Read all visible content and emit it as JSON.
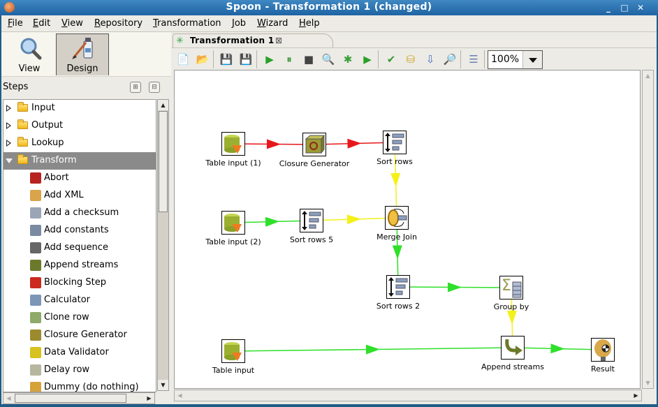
{
  "window": {
    "title": "Spoon - Transformation 1 (changed)",
    "controls": [
      "_",
      "□",
      "✕"
    ]
  },
  "menu": [
    {
      "label": "File",
      "mnemonic": "F"
    },
    {
      "label": "Edit",
      "mnemonic": "E"
    },
    {
      "label": "View",
      "mnemonic": "V"
    },
    {
      "label": "Repository",
      "mnemonic": "R"
    },
    {
      "label": "Transformation",
      "mnemonic": "T"
    },
    {
      "label": "Job",
      "mnemonic": "J"
    },
    {
      "label": "Wizard",
      "mnemonic": "W"
    },
    {
      "label": "Help",
      "mnemonic": "H"
    }
  ],
  "perspectives": {
    "view_label": "View",
    "design_label": "Design",
    "active": "Design"
  },
  "steps_panel": {
    "title": "Steps",
    "categories": [
      {
        "label": "Input",
        "expanded": false
      },
      {
        "label": "Output",
        "expanded": false
      },
      {
        "label": "Lookup",
        "expanded": false
      },
      {
        "label": "Transform",
        "expanded": true,
        "selected": true
      }
    ],
    "transform_steps": [
      {
        "label": "Abort",
        "icon": "abort-icon",
        "color": "#b8231f"
      },
      {
        "label": "Add XML",
        "icon": "add-xml-icon",
        "color": "#d9a44a"
      },
      {
        "label": "Add a checksum",
        "icon": "checksum-icon",
        "color": "#9aa6b6"
      },
      {
        "label": "Add constants",
        "icon": "constants-icon",
        "color": "#7a8aa0"
      },
      {
        "label": "Add sequence",
        "icon": "sequence-icon",
        "color": "#666666"
      },
      {
        "label": "Append streams",
        "icon": "append-streams-icon",
        "color": "#6b7a2a"
      },
      {
        "label": "Blocking Step",
        "icon": "blocking-step-icon",
        "color": "#cc2a1e"
      },
      {
        "label": "Calculator",
        "icon": "calculator-icon",
        "color": "#7d96b8"
      },
      {
        "label": "Clone row",
        "icon": "clone-row-icon",
        "color": "#8fa96a"
      },
      {
        "label": "Closure Generator",
        "icon": "closure-generator-icon",
        "color": "#9b8a2e"
      },
      {
        "label": "Data Validator",
        "icon": "data-validator-icon",
        "color": "#d7c21e"
      },
      {
        "label": "Delay row",
        "icon": "hourglass-icon",
        "color": "#b7b7a0"
      },
      {
        "label": "Dummy (do nothing)",
        "icon": "dummy-icon",
        "color": "#d6a23a"
      }
    ]
  },
  "editor": {
    "tab_label": "Transformation 1",
    "zoom_value": "100%",
    "toolbar": [
      {
        "name": "new-file-icon",
        "glyph": "📄"
      },
      {
        "name": "open-file-icon",
        "glyph": "📂"
      },
      {
        "name": "save-icon",
        "glyph": "💾"
      },
      {
        "name": "save-as-icon",
        "glyph": "💾"
      },
      {
        "name": "run-icon",
        "glyph": "▶"
      },
      {
        "name": "pause-icon",
        "glyph": "⏸"
      },
      {
        "name": "stop-icon",
        "glyph": "■"
      },
      {
        "name": "preview-icon",
        "glyph": "🔍"
      },
      {
        "name": "debug-icon",
        "glyph": "✱"
      },
      {
        "name": "replay-icon",
        "glyph": "▶"
      },
      {
        "name": "verify-icon",
        "glyph": "✔"
      },
      {
        "name": "impact-icon",
        "glyph": "⛁"
      },
      {
        "name": "sql-icon",
        "glyph": "⇩"
      },
      {
        "name": "explore-db-icon",
        "glyph": "🔎"
      },
      {
        "name": "show-results-icon",
        "glyph": "☰"
      }
    ]
  },
  "graph": {
    "colors": {
      "red": "#e8171b",
      "green": "#2fe02a",
      "yellow": "#f4f01a"
    },
    "nodes": [
      {
        "id": "table_input_1",
        "label": "Table input (1)",
        "icon": "table-input-icon"
      },
      {
        "id": "closure_generator",
        "label": "Closure Generator",
        "icon": "closure-generator-icon"
      },
      {
        "id": "sort_rows",
        "label": "Sort rows",
        "icon": "sort-rows-icon"
      },
      {
        "id": "table_input_2",
        "label": "Table input (2)",
        "icon": "table-input-icon"
      },
      {
        "id": "sort_rows_5",
        "label": "Sort rows 5",
        "icon": "sort-rows-icon"
      },
      {
        "id": "merge_join",
        "label": "Merge Join",
        "icon": "merge-join-icon"
      },
      {
        "id": "sort_rows_2",
        "label": "Sort rows 2",
        "icon": "sort-rows-icon"
      },
      {
        "id": "group_by",
        "label": "Group by",
        "icon": "group-by-icon"
      },
      {
        "id": "table_input",
        "label": "Table input",
        "icon": "table-input-icon"
      },
      {
        "id": "append_streams",
        "label": "Append streams",
        "icon": "append-streams-icon"
      },
      {
        "id": "result",
        "label": "Result",
        "icon": "result-icon"
      }
    ],
    "hops": [
      {
        "from": "table_input_1",
        "to": "closure_generator",
        "color": "red"
      },
      {
        "from": "closure_generator",
        "to": "sort_rows",
        "color": "red"
      },
      {
        "from": "sort_rows",
        "to": "merge_join",
        "color": "yellow"
      },
      {
        "from": "table_input_2",
        "to": "sort_rows_5",
        "color": "green"
      },
      {
        "from": "sort_rows_5",
        "to": "merge_join",
        "color": "yellow"
      },
      {
        "from": "merge_join",
        "to": "sort_rows_2",
        "color": "green"
      },
      {
        "from": "sort_rows_2",
        "to": "group_by",
        "color": "green"
      },
      {
        "from": "group_by",
        "to": "append_streams",
        "color": "yellow"
      },
      {
        "from": "table_input",
        "to": "append_streams",
        "color": "green"
      },
      {
        "from": "append_streams",
        "to": "result",
        "color": "green"
      }
    ]
  }
}
